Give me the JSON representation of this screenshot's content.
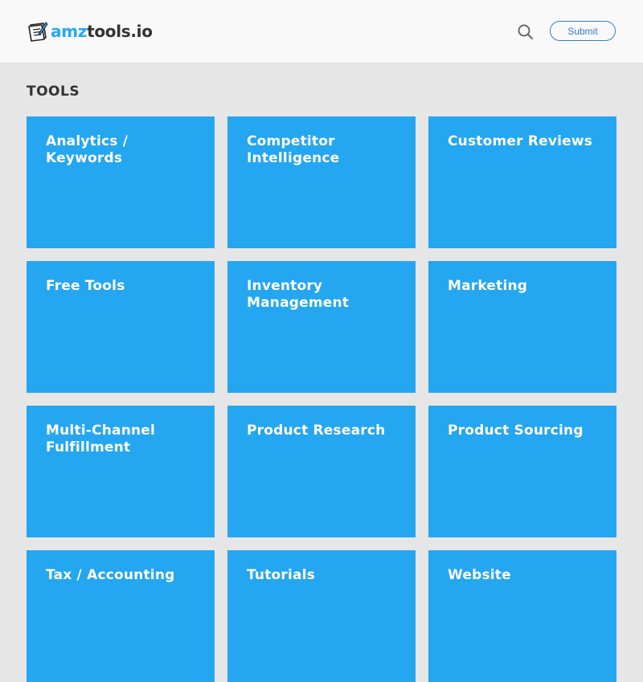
{
  "header": {
    "logo": {
      "prefix": "amz",
      "suffix": "tools.io"
    },
    "search_icon": "search-icon",
    "submit_label": "Submit"
  },
  "section": {
    "title": "TOOLS"
  },
  "tiles": [
    {
      "label": "Analytics /\nKeywords"
    },
    {
      "label": "Competitor\nIntelligence"
    },
    {
      "label": "Customer Reviews"
    },
    {
      "label": "Free Tools"
    },
    {
      "label": "Inventory\nManagement"
    },
    {
      "label": "Marketing"
    },
    {
      "label": "Multi-Channel\nFulfillment"
    },
    {
      "label": "Product Research"
    },
    {
      "label": "Product Sourcing"
    },
    {
      "label": "Tax / Accounting"
    },
    {
      "label": "Tutorials"
    },
    {
      "label": "Website"
    }
  ],
  "colors": {
    "accent": "#25a8f0",
    "tile": "#24a6f0",
    "background": "#e6e6e6",
    "header": "#f9f9f9",
    "button_border": "#3a7ec4"
  }
}
